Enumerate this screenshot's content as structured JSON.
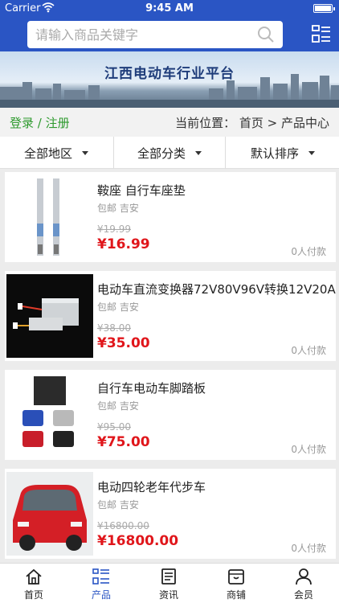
{
  "status": {
    "carrier": "Carrier",
    "time": "9:45 AM"
  },
  "search": {
    "placeholder": "请输入商品关键字"
  },
  "banner": {
    "title": "江西电动车行业平台"
  },
  "crumbbar": {
    "login": "登录 / 注册",
    "location": "当前位置： 首页 > 产品中心"
  },
  "filters": [
    {
      "label": "全部地区"
    },
    {
      "label": "全部分类"
    },
    {
      "label": "默认排序"
    }
  ],
  "products": [
    {
      "name": "鞍座 自行车座垫",
      "meta": "包邮 吉安",
      "old_price": "¥19.99",
      "price": "¥16.99",
      "sold": "0人付款",
      "image": "bike-fork-image"
    },
    {
      "name": "电动车直流变换器72V80V96V转换12V20A",
      "meta": "包邮 吉安",
      "old_price": "¥38.00",
      "price": "¥35.00",
      "sold": "0人付款",
      "image": "dc-converter-image"
    },
    {
      "name": "自行车电动车脚踏板",
      "meta": "包邮 吉安",
      "old_price": "¥95.00",
      "price": "¥75.00",
      "sold": "0人付款",
      "image": "pedals-image"
    },
    {
      "name": "电动四轮老年代步车",
      "meta": "包邮 吉安",
      "old_price": "¥16800.00",
      "price": "¥16800.00",
      "sold": "0人付款",
      "image": "mini-car-image"
    }
  ],
  "tabs": [
    {
      "label": "首页",
      "icon": "home-icon"
    },
    {
      "label": "产品",
      "icon": "list-icon"
    },
    {
      "label": "资讯",
      "icon": "news-icon"
    },
    {
      "label": "商铺",
      "icon": "shop-icon"
    },
    {
      "label": "会员",
      "icon": "user-icon"
    }
  ],
  "colors": {
    "brand": "#2a55c4",
    "price": "#e0161b",
    "login": "#2e9a2e"
  }
}
